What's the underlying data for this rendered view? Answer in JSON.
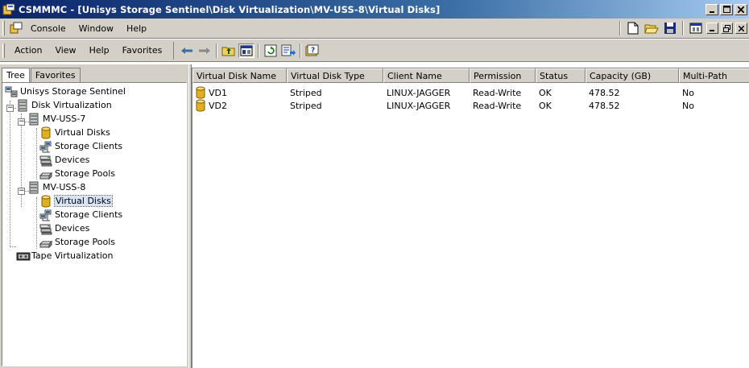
{
  "window": {
    "title": "CSMMMC - [Unisys Storage Sentinel\\Disk Virtualization\\MV-USS-8\\Virtual Disks]",
    "icon": "csmmmc-app-icon"
  },
  "menubar": {
    "items": [
      {
        "label": "Console",
        "icon": "console-icon"
      },
      {
        "label": "Window"
      },
      {
        "label": "Help"
      }
    ]
  },
  "actionbar": {
    "items": [
      {
        "label": "Action"
      },
      {
        "label": "View"
      },
      {
        "label": "Help"
      },
      {
        "label": "Favorites"
      }
    ]
  },
  "tabs": [
    {
      "label": "Tree",
      "active": true
    },
    {
      "label": "Favorites",
      "active": false
    }
  ],
  "tree": [
    {
      "label": "Unisys Storage Sentinel",
      "icon": "storage-sentinel-icon",
      "level": 0
    },
    {
      "label": "Disk Virtualization",
      "icon": "server-icon",
      "level": 0,
      "expanded": true
    },
    {
      "label": "MV-USS-7",
      "icon": "server-icon",
      "level": 1,
      "expanded": true
    },
    {
      "label": "Virtual Disks",
      "icon": "virtual-disk-icon",
      "level": 2
    },
    {
      "label": "Storage Clients",
      "icon": "storage-clients-icon",
      "level": 2
    },
    {
      "label": "Devices",
      "icon": "devices-icon",
      "level": 2
    },
    {
      "label": "Storage Pools",
      "icon": "storage-pool-icon",
      "level": 2
    },
    {
      "label": "MV-USS-8",
      "icon": "server-icon",
      "level": 1,
      "expanded": true
    },
    {
      "label": "Virtual Disks",
      "icon": "virtual-disk-icon",
      "level": 2,
      "selected": true
    },
    {
      "label": "Storage Clients",
      "icon": "storage-clients-icon",
      "level": 2
    },
    {
      "label": "Devices",
      "icon": "devices-icon",
      "level": 2
    },
    {
      "label": "Storage Pools",
      "icon": "storage-pool-icon",
      "level": 2
    },
    {
      "label": "Tape Virtualization",
      "icon": "tape-icon",
      "level": 0
    }
  ],
  "table": {
    "columns": [
      "Virtual Disk Name",
      "Virtual Disk Type",
      "Client Name",
      "Permission",
      "Status",
      "Capacity (GB)",
      "Multi-Path"
    ],
    "rows": [
      [
        "VD1",
        "Striped",
        "LINUX-JAGGER",
        "Read-Write",
        "OK",
        "478.52",
        "No"
      ],
      [
        "VD2",
        "Striped",
        "LINUX-JAGGER",
        "Read-Write",
        "OK",
        "478.52",
        "No"
      ]
    ]
  },
  "colors": {
    "title_gradient_start": "#0a246a",
    "title_gradient_end": "#a6caf0",
    "chrome": "#d4d0c8",
    "selection": "#d6e4f5"
  }
}
